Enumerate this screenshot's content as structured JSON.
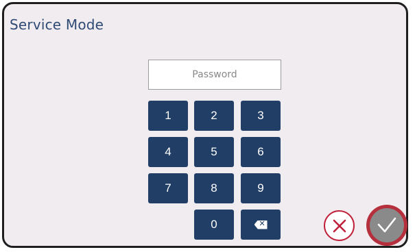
{
  "dialog": {
    "title": "Service Mode"
  },
  "password": {
    "placeholder": "Password"
  },
  "keypad": {
    "keys": [
      "1",
      "2",
      "3",
      "4",
      "5",
      "6",
      "7",
      "8",
      "9",
      "0"
    ],
    "backspace_icon": "backspace-icon"
  },
  "actions": {
    "cancel_icon": "close-icon",
    "confirm_icon": "check-icon"
  },
  "colors": {
    "title": "#2f4a74",
    "key_bg": "#213e66",
    "cancel": "#c0203a",
    "confirm_ring": "#b52f3c",
    "confirm_fill": "#8a8a8a"
  }
}
